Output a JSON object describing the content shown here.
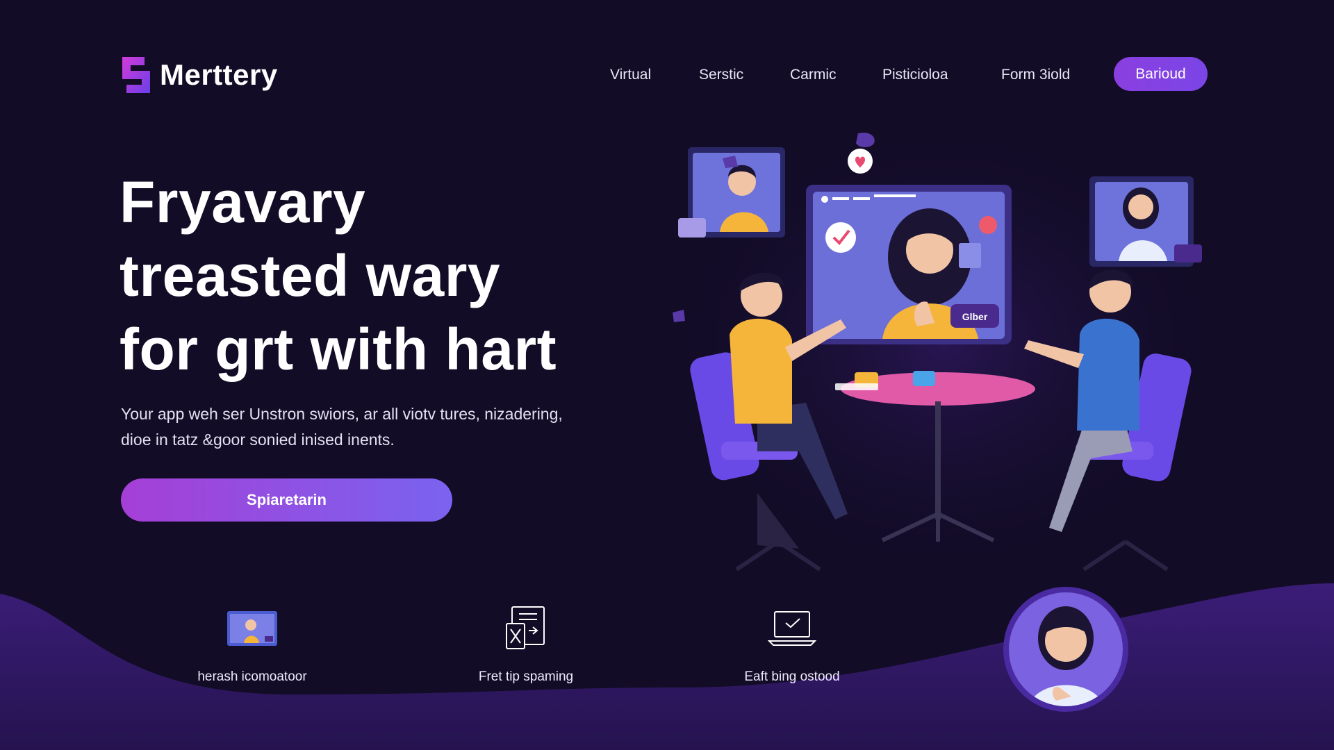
{
  "brand": {
    "name": "Merttery"
  },
  "nav": {
    "items": [
      "Virtual",
      "Serstic",
      "Carmic",
      "Pisticioloa",
      "Form 3iold"
    ],
    "cta_label": "Barioud"
  },
  "hero": {
    "title_lines": [
      "Fryavary",
      "treasted wary",
      "for grt with hart"
    ],
    "subtitle_lines": [
      "Your app weh ser Unstron swiors, ar all viotv tures, nizadering,",
      "dioe in tatz &goor sonied inised inents."
    ],
    "button_label": "Spiaretarin"
  },
  "illustration": {
    "center_screen_badge": "Glber"
  },
  "features": [
    {
      "icon": "video-call-icon",
      "label": "herash icomoatoor"
    },
    {
      "icon": "document-transfer-icon",
      "label": "Fret tip spaming"
    },
    {
      "icon": "laptop-icon",
      "label": "Eaft bing ostood"
    }
  ],
  "colors": {
    "background": "#120c26",
    "accent": "#8a3fe0",
    "wave": "#3a1f73"
  }
}
